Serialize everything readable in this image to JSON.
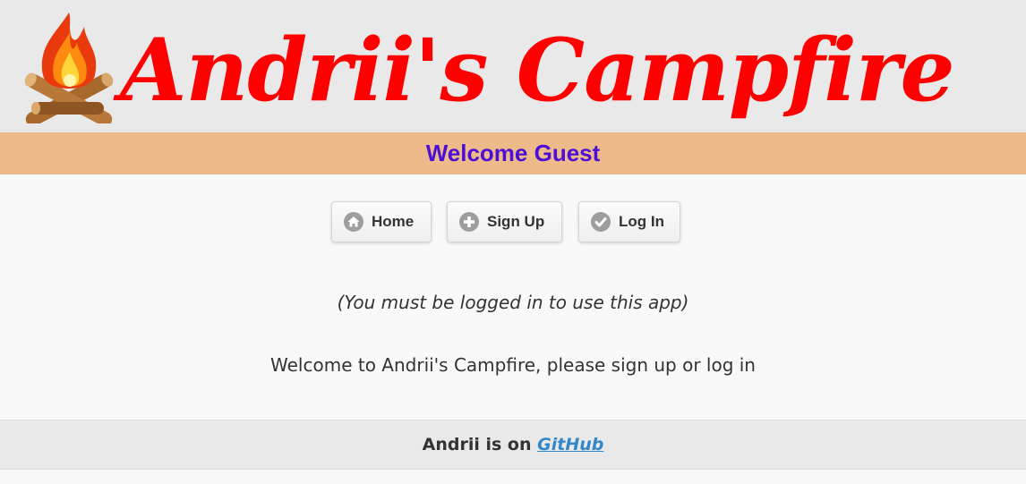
{
  "header": {
    "title": "Andrii's Campfire",
    "logo_icon": "campfire-icon",
    "title_color": "#ff0000"
  },
  "welcome_bar": {
    "text": "Welcome Guest",
    "background": "#efba8a",
    "text_color": "#4b0fd6"
  },
  "nav": {
    "buttons": [
      {
        "label": "Home",
        "icon": "home-icon"
      },
      {
        "label": "Sign Up",
        "icon": "plus-circle-icon"
      },
      {
        "label": "Log In",
        "icon": "check-circle-icon"
      }
    ]
  },
  "content": {
    "note": "(You must be logged in to use this app)",
    "message": "Welcome to Andrii's Campfire, please sign up or log in"
  },
  "footer": {
    "prefix": "Andrii is on ",
    "link_text": "GitHub",
    "link_color": "#3388cc"
  }
}
